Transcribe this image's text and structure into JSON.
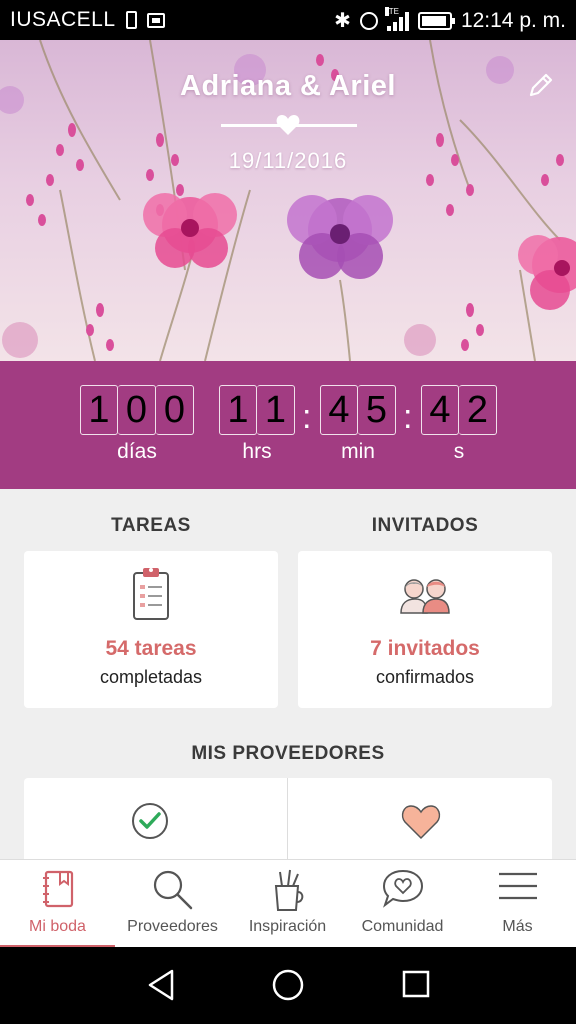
{
  "status_bar": {
    "carrier": "IUSACELL",
    "network": "LTE",
    "time": "12:14 p. m."
  },
  "header": {
    "couple_names": "Adriana & Ariel",
    "wedding_date": "19/11/2016"
  },
  "countdown": {
    "days_digits": [
      "1",
      "0",
      "0"
    ],
    "hours_digits": [
      "1",
      "1"
    ],
    "minutes_digits": [
      "4",
      "5"
    ],
    "seconds_digits": [
      "4",
      "2"
    ],
    "days_label": "días",
    "hours_label": "hrs",
    "minutes_label": "min",
    "seconds_label": "s"
  },
  "tasks": {
    "section_title": "TAREAS",
    "count_label": "54 tareas",
    "sub_label": "completadas",
    "icon": "clipboard-checklist-icon"
  },
  "guests": {
    "section_title": "INVITADOS",
    "count_label": "7 invitados",
    "sub_label": "confirmados",
    "icon": "guests-couple-icon"
  },
  "providers": {
    "section_title": "MIS PROVEEDORES",
    "left_icon": "checkmark-circle-icon",
    "right_icon": "heart-icon"
  },
  "bottom_nav": {
    "items": [
      {
        "label": "Mi boda",
        "icon": "notebook-icon",
        "active": true
      },
      {
        "label": "Proveedores",
        "icon": "search-icon",
        "active": false
      },
      {
        "label": "Inspiración",
        "icon": "cup-pencils-icon",
        "active": false
      },
      {
        "label": "Comunidad",
        "icon": "chat-heart-icon",
        "active": false
      },
      {
        "label": "Más",
        "icon": "menu-icon",
        "active": false
      }
    ]
  },
  "colors": {
    "brand_magenta": "#a23c82",
    "accent_coral": "#d0626a",
    "count_coral": "#d56a6a",
    "background_gray": "#efefef"
  }
}
